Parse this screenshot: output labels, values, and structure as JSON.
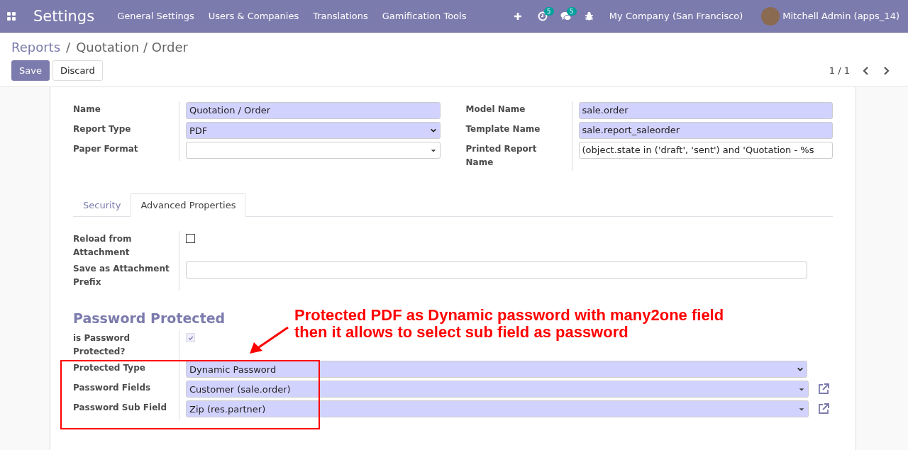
{
  "navbar": {
    "app_title": "Settings",
    "menu": [
      "General Settings",
      "Users & Companies",
      "Translations",
      "Gamification Tools"
    ],
    "activity_count": "5",
    "message_count": "5",
    "company": "My Company (San Francisco)",
    "user": "Mitchell Admin (apps_14)"
  },
  "breadcrumb": [
    "Reports",
    "Quotation / Order"
  ],
  "breadcrumb_separator": "/",
  "buttons": [
    {
      "label": "Save",
      "kind": "primary"
    },
    {
      "label": "Discard",
      "kind": "secondary"
    }
  ],
  "pager": "1 / 1",
  "top_groups": [
    {
      "fields": [
        {
          "label": "Name",
          "kind": "input",
          "value": "Quotation / Order",
          "required": true
        },
        {
          "label": "Report Type",
          "kind": "select",
          "value": "PDF",
          "required": true
        },
        {
          "label": "Paper Format",
          "kind": "many2one",
          "required": false
        }
      ]
    },
    {
      "fields": [
        {
          "label": "Model Name",
          "kind": "input",
          "value": "sale.order",
          "required": true
        },
        {
          "label": "Template Name",
          "kind": "input",
          "value": "sale.report_saleorder",
          "required": true
        },
        {
          "label": "Printed Report Name",
          "kind": "input",
          "value": "(object.state in ('draft', 'sent') and 'Quotation - %s",
          "required": false
        }
      ]
    }
  ],
  "tabs": [
    {
      "label": "Security",
      "selected": false
    },
    {
      "label": "Advanced Properties",
      "selected": true
    }
  ],
  "tab_fields": [
    {
      "label": "Reload from Attachment",
      "kind": "checkbox",
      "checked": false,
      "disabled": false
    },
    {
      "label": "Save as Attachment Prefix",
      "kind": "input",
      "required": false
    }
  ],
  "section_title": "Password Protected",
  "section_fields": [
    {
      "label": "is Password Protected?",
      "kind": "checkbox",
      "checked": true,
      "disabled": true
    },
    {
      "label": "Protected Type",
      "kind": "select",
      "value": "Dynamic Password",
      "required": true
    },
    {
      "label": "Password Fields",
      "kind": "many2one",
      "value": "Customer (sale.order)",
      "required": true,
      "external_link": true
    },
    {
      "label": "Password Sub Field",
      "kind": "many2one",
      "value": "Zip (res.partner)",
      "required": true,
      "external_link": true
    }
  ],
  "annotation": {
    "lines": [
      "Protected PDF as Dynamic password with many2one field",
      "then it allows to select sub field as password"
    ]
  }
}
